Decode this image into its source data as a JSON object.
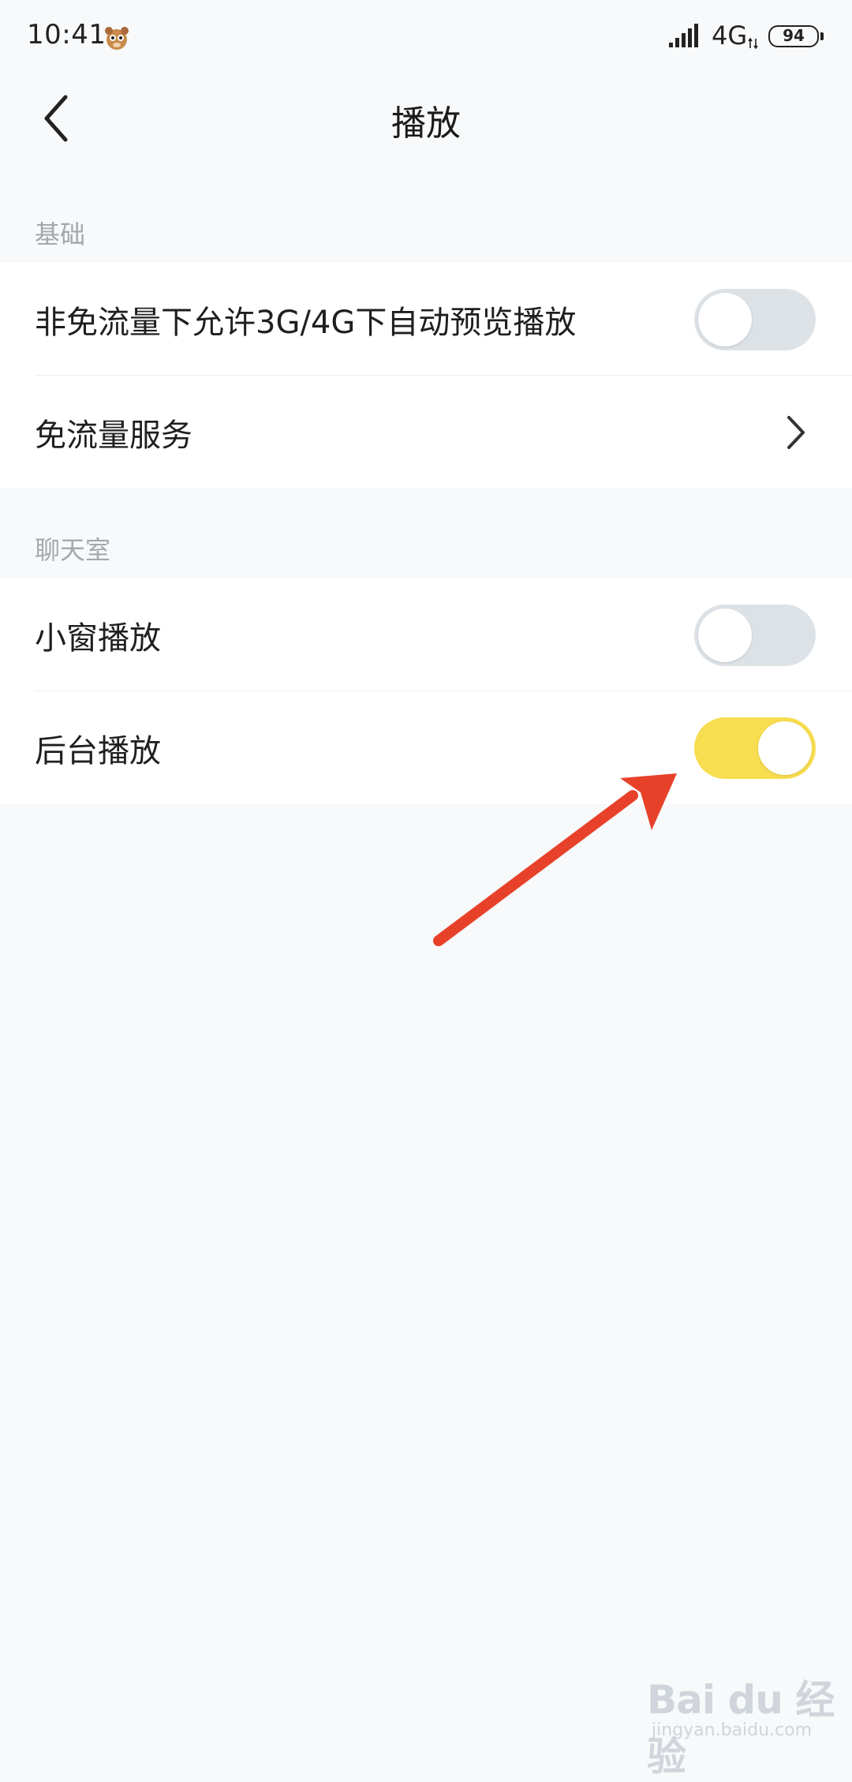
{
  "status_bar": {
    "time": "10:41",
    "network": "4G",
    "battery": "94"
  },
  "header": {
    "title": "播放"
  },
  "sections": [
    {
      "title": "基础",
      "items": [
        {
          "label": "非免流量下允许3G/4G下自动预览播放",
          "control": "toggle",
          "on": false
        },
        {
          "label": "免流量服务",
          "control": "chevron-right-icon"
        }
      ]
    },
    {
      "title": "聊天室",
      "items": [
        {
          "label": "小窗播放",
          "control": "toggle",
          "on": false
        },
        {
          "label": "后台播放",
          "control": "toggle",
          "on": true
        }
      ]
    }
  ],
  "colors": {
    "background": "#f7f9fa",
    "toggle_on": "#f7dd4f",
    "toggle_off": "#dde2e7",
    "annotation_arrow": "#e8412a"
  },
  "watermark": {
    "logo": "Bai du 经验",
    "url": "jingyan.baidu.com"
  }
}
